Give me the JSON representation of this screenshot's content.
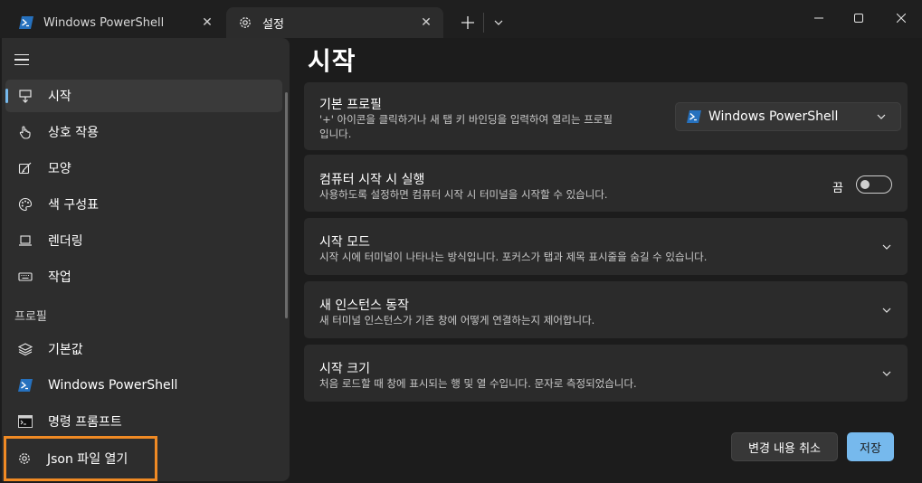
{
  "tabs": [
    {
      "label": "Windows PowerShell",
      "active": false,
      "icon": "powershell-icon"
    },
    {
      "label": "설정",
      "active": true,
      "icon": "gear-icon"
    }
  ],
  "window_controls": [
    "minimize-icon",
    "maximize-icon",
    "close-icon"
  ],
  "sidebar": {
    "items": [
      {
        "label": "시작",
        "icon": "launch-icon",
        "selected": true
      },
      {
        "label": "상호 작용",
        "icon": "hand-pointer-icon"
      },
      {
        "label": "모양",
        "icon": "paint-edit-icon"
      },
      {
        "label": "색 구성표",
        "icon": "palette-icon"
      },
      {
        "label": "렌더링",
        "icon": "monitor-icon"
      },
      {
        "label": "작업",
        "icon": "keyboard-icon"
      }
    ],
    "profiles_header": "프로필",
    "profiles": [
      {
        "label": "기본값",
        "icon": "layers-icon"
      },
      {
        "label": "Windows PowerShell",
        "icon": "powershell-icon"
      },
      {
        "label": "명령 프롬프트",
        "icon": "cmd-icon"
      }
    ],
    "json_open": "Json 파일 열기"
  },
  "page": {
    "title": "시작",
    "cards": [
      {
        "title": "기본 프로필",
        "desc_line1": "'+' 아이콘을 클릭하거나 새 탭 키 바인딩을 입력하여 열리는 프로필",
        "desc_line2": "입니다."
      },
      {
        "title": "컴퓨터 시작 시 실행",
        "desc": "사용하도록 설정하면 컴퓨터 시작 시 터미널을 시작할 수 있습니다."
      },
      {
        "title": "시작 모드",
        "desc": "시작 시에 터미널이 나타나는 방식입니다. 포커스가 탭과 제목 표시줄을 숨길 수 있습니다."
      },
      {
        "title": "새 인스턴스 동작",
        "desc": "새 터미널 인스턴스가 기존 창에 어떻게 연결하는지 제어합니다."
      },
      {
        "title": "시작 크기",
        "desc": "처음 로드할 때 창에 표시되는 행 및 열 수입니다. 문자로 측정되었습니다."
      }
    ],
    "default_profile_value": "Windows PowerShell",
    "launch_on_startup_state": "끔",
    "discard_button": "변경 내용 취소",
    "save_button": "저장"
  },
  "colors": {
    "accent": "#76b9ed",
    "highlight_border": "#f08a24",
    "powershell": "#2671be"
  }
}
